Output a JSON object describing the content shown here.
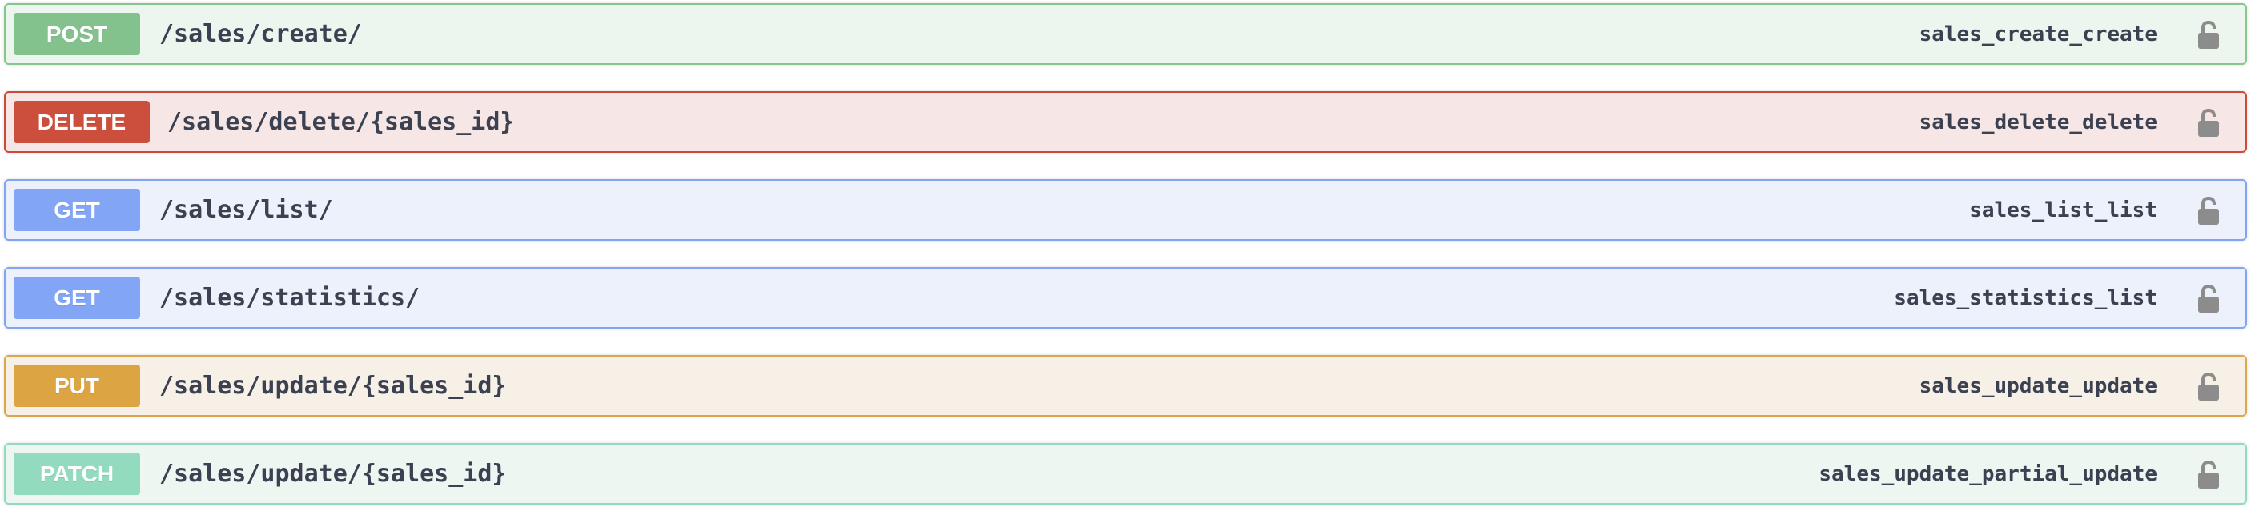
{
  "colors": {
    "post": {
      "badge": "#49cc90",
      "bg": "#edf6ee",
      "border": "#86c78f"
    },
    "delete": {
      "badge": "#f93e3e",
      "bg": "#f6e6e5",
      "border": "#cd4a3a"
    },
    "get": {
      "badge": "#61affe",
      "bg": "#edf1fb",
      "border": "#82a4f3"
    },
    "put": {
      "badge": "#fca130",
      "bg": "#f7f0e6",
      "border": "#dca64b"
    },
    "patch": {
      "badge": "#50e3c2",
      "bg": "#eef6f2",
      "border": "#93d9bf"
    },
    "lock": "#8c8c8c"
  },
  "operations": [
    {
      "method": "POST",
      "path": "/sales/create/",
      "operation_id": "sales_create_create",
      "lock_icon": "unlocked-padlock-icon"
    },
    {
      "method": "DELETE",
      "path": "/sales/delete/{sales_id}",
      "operation_id": "sales_delete_delete",
      "lock_icon": "unlocked-padlock-icon"
    },
    {
      "method": "GET",
      "path": "/sales/list/",
      "operation_id": "sales_list_list",
      "lock_icon": "unlocked-padlock-icon"
    },
    {
      "method": "GET",
      "path": "/sales/statistics/",
      "operation_id": "sales_statistics_list",
      "lock_icon": "unlocked-padlock-icon"
    },
    {
      "method": "PUT",
      "path": "/sales/update/{sales_id}",
      "operation_id": "sales_update_update",
      "lock_icon": "unlocked-padlock-icon"
    },
    {
      "method": "PATCH",
      "path": "/sales/update/{sales_id}",
      "operation_id": "sales_update_partial_update",
      "lock_icon": "unlocked-padlock-icon"
    }
  ]
}
